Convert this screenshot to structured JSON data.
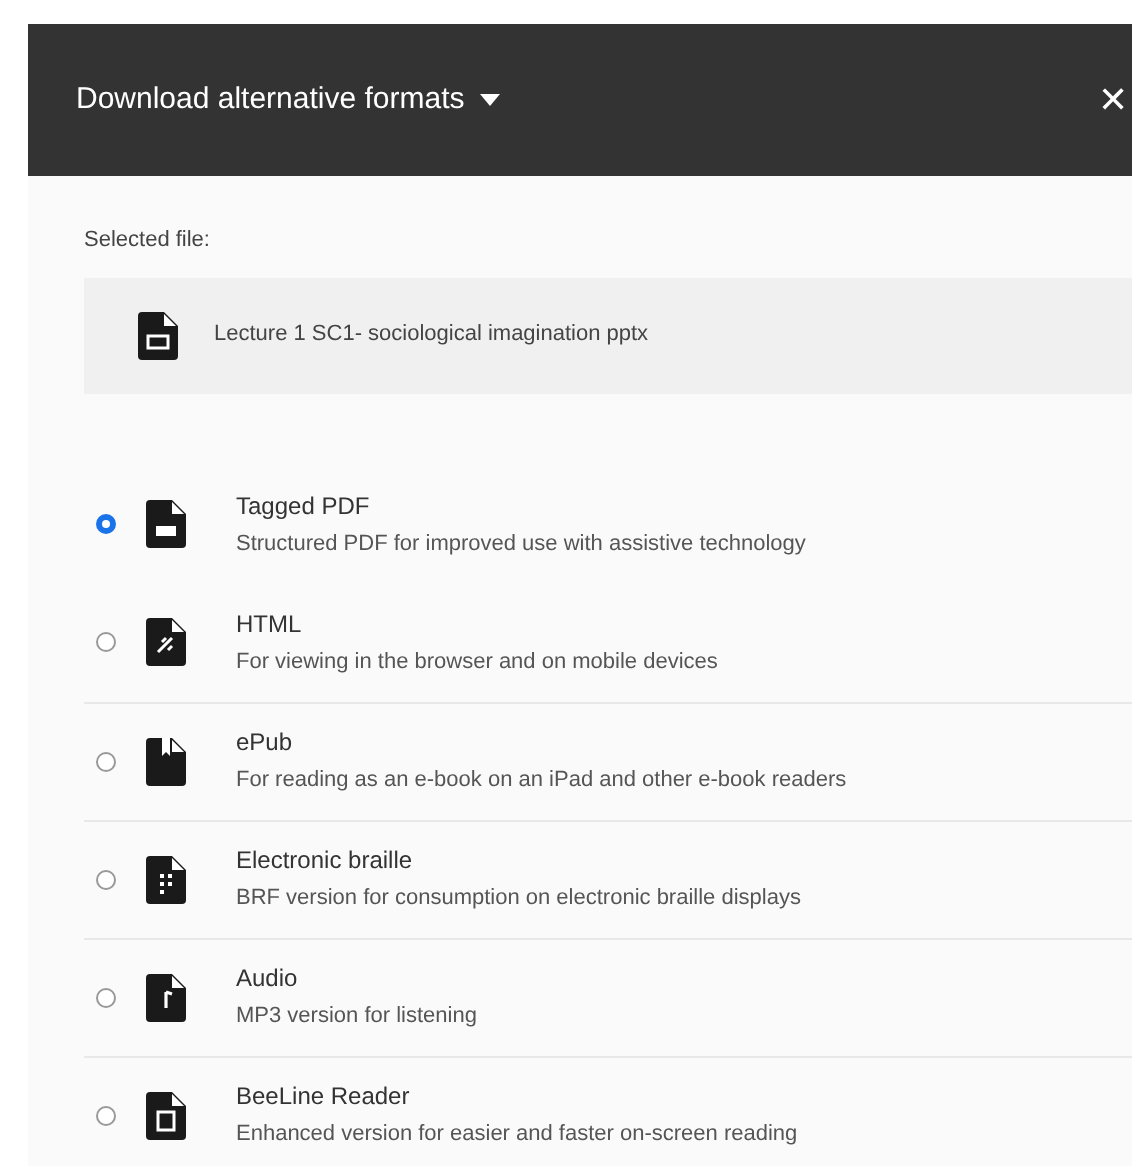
{
  "dialog": {
    "title": "Download alternative formats",
    "close": "✕"
  },
  "selected_file": {
    "label": "Selected file:",
    "name": "Lecture 1 SC1- sociological imagination pptx"
  },
  "formats": [
    {
      "kind": "pdf",
      "title": "Tagged PDF",
      "description": "Structured PDF for improved use with assistive technology",
      "selected": true
    },
    {
      "kind": "html",
      "title": "HTML",
      "description": "For viewing in the browser and on mobile devices",
      "selected": false
    },
    {
      "kind": "epub",
      "title": "ePub",
      "description": "For reading as an e-book on an iPad and other e-book readers",
      "selected": false
    },
    {
      "kind": "braille",
      "title": "Electronic braille",
      "description": "BRF version for consumption on electronic braille displays",
      "selected": false
    },
    {
      "kind": "audio",
      "title": "Audio",
      "description": "MP3 version for listening",
      "selected": false
    },
    {
      "kind": "beeline",
      "title": "BeeLine Reader",
      "description": "Enhanced version for easier and faster on-screen reading",
      "selected": false
    }
  ]
}
